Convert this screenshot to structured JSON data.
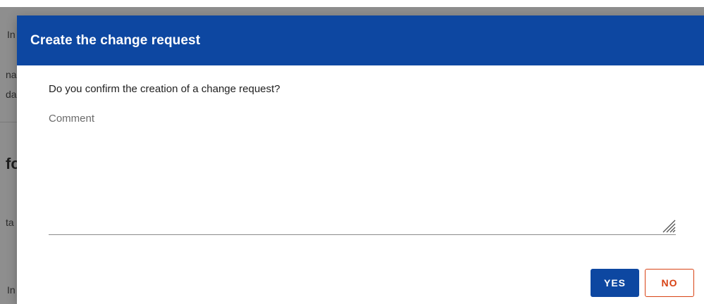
{
  "background": {
    "fragments": [
      "In",
      "na",
      "da",
      "fo",
      "ta",
      "In"
    ]
  },
  "dialog": {
    "title": "Create the change request",
    "question": "Do you confirm the creation of a change request?",
    "comment": {
      "label": "Comment",
      "value": ""
    },
    "buttons": {
      "yes_label": "YES",
      "no_label": "NO"
    }
  },
  "colors": {
    "header": "#0d47a1",
    "primary_button": "#0d47a1",
    "secondary_button_text": "#d84315",
    "overlay": "#8e8e8e"
  }
}
